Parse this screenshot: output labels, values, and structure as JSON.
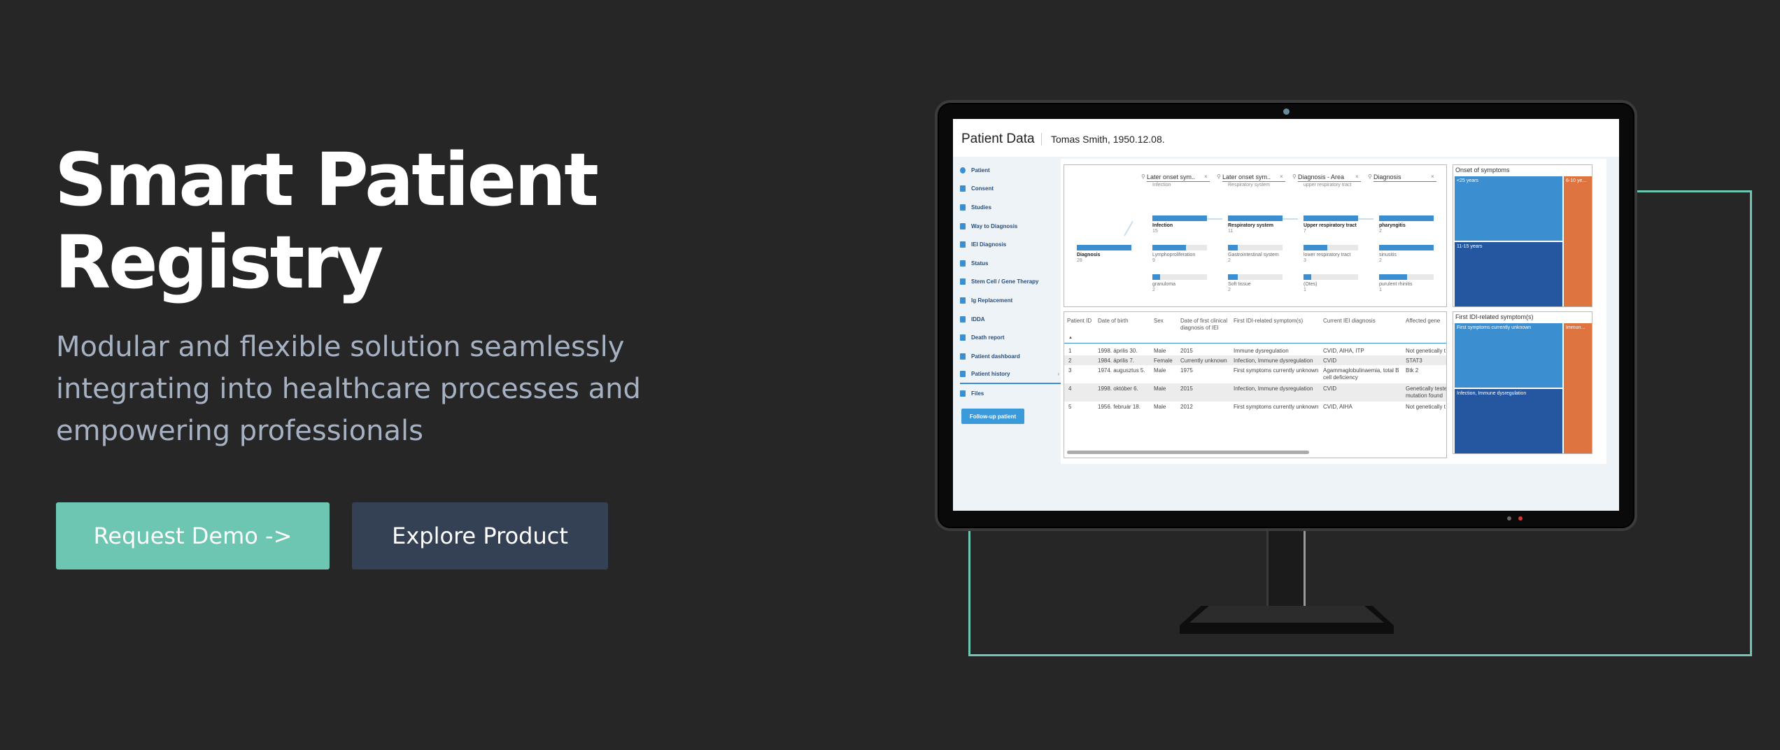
{
  "hero": {
    "title_line1": "Smart Patient",
    "title_line2": "Registry",
    "subtitle_line1": "Modular and flexible solution seamlessly",
    "subtitle_line2": "integrating into healthcare processes and",
    "subtitle_line3": "empowering professionals",
    "demo_button": "Request Demo ->",
    "explore_button": "Explore Product"
  },
  "colors": {
    "background": "#262626",
    "accent": "#6dc6b1",
    "secondary_button": "#344054",
    "subtitle": "#a6b2c3",
    "chart_blue": "#3b8fd0",
    "chart_dark_blue": "#2457a0",
    "chart_orange": "#de7540"
  },
  "screen": {
    "title": "Patient Data",
    "patient": "Tomas Smith, 1950.12.08.",
    "nav": [
      {
        "label": "Patient",
        "icon": "info-icon"
      },
      {
        "label": "Consent",
        "icon": "consent-icon"
      },
      {
        "label": "Studies",
        "icon": "document-icon"
      },
      {
        "label": "Way to Diagnosis",
        "icon": "route-icon"
      },
      {
        "label": "IEI Diagnosis",
        "icon": "dna-icon"
      },
      {
        "label": "Status",
        "icon": "document-icon"
      },
      {
        "label": "Stem Cell / Gene Therapy",
        "icon": "syringe-icon"
      },
      {
        "label": "Ig Replacement",
        "icon": "syringe-icon"
      },
      {
        "label": "IDDA",
        "icon": "document-icon"
      },
      {
        "label": "Death report",
        "icon": "document-icon"
      },
      {
        "label": "Patient dashboard",
        "icon": "dashboard-icon"
      },
      {
        "label": "Patient history",
        "icon": "dna-icon"
      },
      {
        "label": "Files",
        "icon": "folder-icon"
      }
    ],
    "follow_up_button": "Follow-up patient",
    "flow": {
      "columns": [
        {
          "title": "Later onset sym..",
          "sub": "Infection"
        },
        {
          "title": "Later onset sym..",
          "sub": "Respiratory system"
        },
        {
          "title": "Diagnosis - Area",
          "sub": "upper respiratory tract"
        },
        {
          "title": "Diagnosis",
          "sub": ""
        }
      ],
      "root": {
        "label": "Diagnosis",
        "count": "28"
      },
      "nodes": [
        [
          {
            "label": "Infection",
            "count": "15"
          },
          {
            "label": "Lymphoproliferation",
            "count": "9"
          },
          {
            "label": "granuloma",
            "count": "2"
          }
        ],
        [
          {
            "label": "Respiratory system",
            "count": "11"
          },
          {
            "label": "Gastrointestinal system",
            "count": "2"
          },
          {
            "label": "Soft tissue",
            "count": "2"
          }
        ],
        [
          {
            "label": "Upper respiratory tract",
            "count": "7"
          },
          {
            "label": "lower respiratory tract",
            "count": "3"
          },
          {
            "label": "(Otes)",
            "count": "1"
          }
        ],
        [
          {
            "label": "pharyngitis",
            "count": "2"
          },
          {
            "label": "sinusitis",
            "count": "2"
          },
          {
            "label": "purulent rhinitis",
            "count": "1"
          }
        ]
      ]
    },
    "table": {
      "headers": [
        "Patient ID",
        "Date of birth",
        "Sex",
        "Date of first clinical diagnosis of IEI",
        "First IDI-related symptom(s)",
        "Current IEI diagnosis",
        "Affected gene"
      ],
      "rows": [
        [
          "1",
          "1998. április 30.",
          "Male",
          "2015",
          "Immune dysregulation",
          "CVID, AIHA, ITP",
          "Not genetically t"
        ],
        [
          "2",
          "1984. április 7.",
          "Female",
          "Currently unknown",
          "Infection, Immune dysregulation",
          "CVID",
          "STAT3"
        ],
        [
          "3",
          "1974. augusztus 5.",
          "Male",
          "1975",
          "First symptoms currently unknown",
          "Agammaglobulinaemia, total B cell deficiency",
          "Btk 2"
        ],
        [
          "4",
          "1998. október 6.",
          "Male",
          "2015",
          "Infection, Immune dysregulation",
          "CVID",
          "Genetically teste mutation found"
        ],
        [
          "5",
          "1956. február 18.",
          "Male",
          "2012",
          "First symptoms currently unknown",
          "CVID, AIHA",
          "Not genetically t"
        ]
      ]
    },
    "treemap_onset": {
      "title": "Onset of symptoms",
      "cells": [
        "<25 years",
        "11-15 years",
        "6-10 ye..."
      ]
    },
    "treemap_symptoms": {
      "title": "First IDI-related symptom(s)",
      "cells": [
        "First symptoms currently unknown",
        "Infection, Immune dysregulation",
        "Immun..."
      ]
    }
  }
}
